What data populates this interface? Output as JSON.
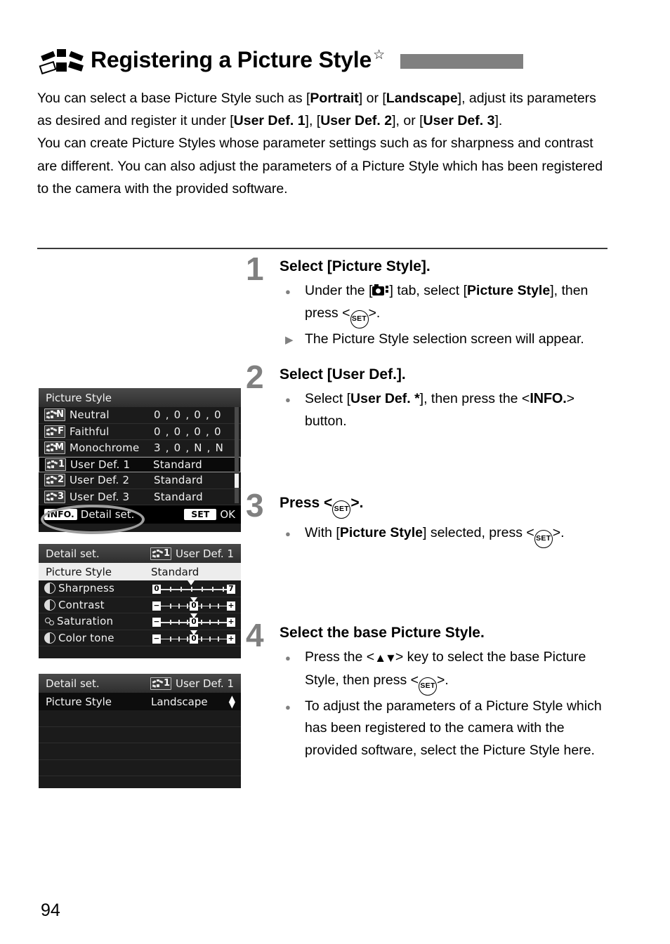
{
  "header": {
    "icon": "picture-style-icon",
    "title": "Registering a Picture Style",
    "star": "☆",
    "gray_bar_color": "#808080"
  },
  "intro": {
    "line1_a": "You can select a base Picture Style such as [",
    "line1_b": "Portrait",
    "line1_c": "] or [",
    "line1_d": "Landscape",
    "line1_e": "], adjust its parameters as desired and register it under [",
    "line1_f": "User Def. 1",
    "line1_g": "], [",
    "line1_h": "User Def. 2",
    "line1_i": "], or [",
    "line1_j": "User Def. 3",
    "line1_k": "].",
    "paragraph2": "You can create Picture Styles whose parameter settings such as for sharpness and contrast are different. You can also adjust the parameters of a Picture Style which has been registered to the camera with the provided software."
  },
  "steps": [
    {
      "number": "1",
      "title": "Select [Picture Style].",
      "bullets": [
        {
          "marker": "dot",
          "parts": [
            "Under the [",
            "CAM_TAB",
            "] tab, select [",
            "Picture Style",
            "], then press <",
            "SET",
            ">."
          ]
        },
        {
          "marker": "tri",
          "text": "The Picture Style selection screen will appear."
        }
      ]
    },
    {
      "number": "2",
      "title": "Select [User Def.].",
      "bullets": [
        {
          "marker": "dot",
          "parts": [
            "Select [",
            "User Def. *",
            "], then press the <",
            "INFO.",
            "> button."
          ]
        }
      ]
    },
    {
      "number": "3",
      "title": "Press <SET>.",
      "bullets": [
        {
          "marker": "dot",
          "parts": [
            "With [",
            "Picture Style",
            "] selected, press <",
            "SET",
            ">."
          ]
        }
      ]
    },
    {
      "number": "4",
      "title": "Select the base Picture Style.",
      "bullets": [
        {
          "marker": "dot",
          "parts": [
            "Press the <",
            "UPDOWN",
            "> key to select the base Picture Style, then press <",
            "SET",
            ">."
          ]
        },
        {
          "marker": "dot",
          "text": "To adjust the parameters of a Picture Style which has been registered to the camera with the provided software, select the Picture Style here."
        }
      ]
    }
  ],
  "screen1": {
    "title": "Picture Style",
    "rows": [
      {
        "badge": "N",
        "name": "Neutral",
        "value": "0 , 0 , 0 , 0",
        "selected": false
      },
      {
        "badge": "F",
        "name": "Faithful",
        "value": "0 , 0 , 0 , 0",
        "selected": false
      },
      {
        "badge": "M",
        "name": "Monochrome",
        "value": "3 , 0 , N , N",
        "selected": false
      },
      {
        "badge": "1",
        "name": "User Def. 1",
        "value": "Standard",
        "selected": true
      },
      {
        "badge": "2",
        "name": "User Def. 2",
        "value": "Standard",
        "selected": false
      },
      {
        "badge": "3",
        "name": "User Def. 3",
        "value": "Standard",
        "selected": false
      }
    ],
    "footer_left_pill": "INFO.",
    "footer_left_label": "Detail set.",
    "footer_right_pill": "SET",
    "footer_right_label": "OK"
  },
  "screen2": {
    "head_left": "Detail set.",
    "head_badge": "1",
    "head_right": "User Def. 1",
    "ps_label": "Picture Style",
    "ps_value": "Standard",
    "params": [
      {
        "icon": "sharpness-icon",
        "name": "Sharpness",
        "left": "0",
        "right": "7",
        "value": "",
        "pos": 50
      },
      {
        "icon": "contrast-icon",
        "name": "Contrast",
        "left": "−",
        "right": "+",
        "value": "0",
        "pos": 50
      },
      {
        "icon": "saturation-icon",
        "name": "Saturation",
        "left": "−",
        "right": "+",
        "value": "0",
        "pos": 50
      },
      {
        "icon": "colortone-icon",
        "name": "Color tone",
        "left": "−",
        "right": "+",
        "value": "0",
        "pos": 50
      }
    ]
  },
  "screen3": {
    "head_left": "Detail set.",
    "head_badge": "1",
    "head_right": "User Def. 1",
    "ps_label": "Picture Style",
    "ps_value": "Landscape",
    "spinner": "▲▼"
  },
  "page_number": "94"
}
